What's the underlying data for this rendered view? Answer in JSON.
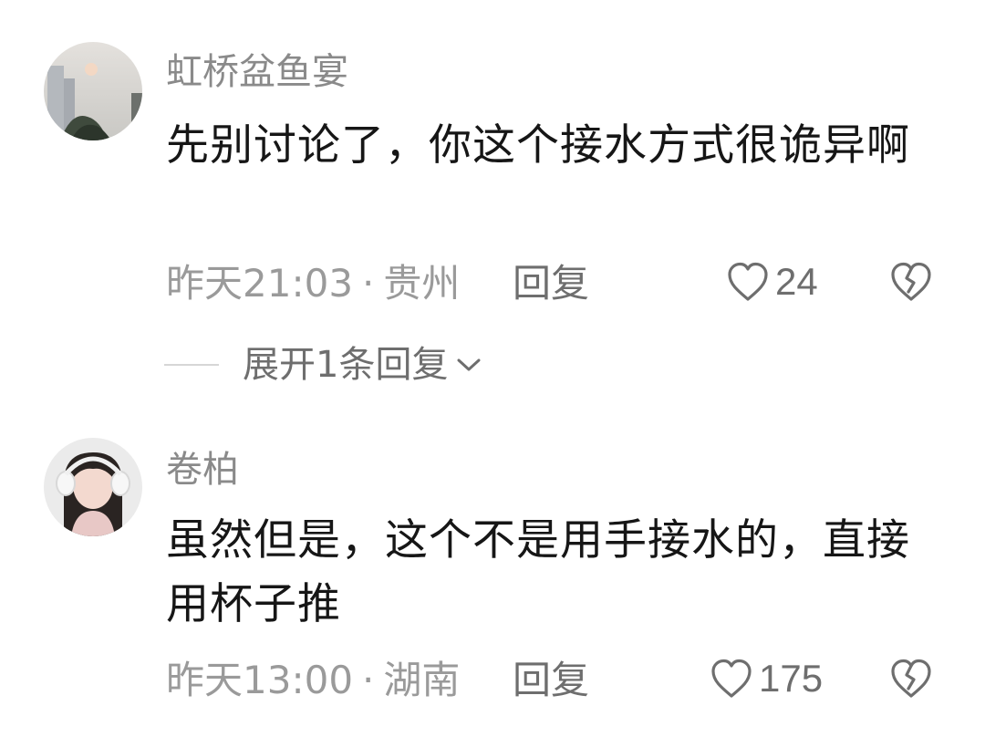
{
  "comments": [
    {
      "username": "虹桥盆鱼宴",
      "text": "先别讨论了，你这个接水方式很诡异啊",
      "time": "昨天21:03",
      "location": "贵州",
      "reply_label": "回复",
      "likes": "24",
      "avatar_icon": "landscape-avatar",
      "expand_label": "展开1条回复"
    },
    {
      "username": "卷柏",
      "text": "虽然但是，这个不是用手接水的，直接用杯子推",
      "time": "昨天13:00",
      "location": "湖南",
      "reply_label": "回复",
      "likes": "175",
      "avatar_icon": "girl-avatar"
    }
  ],
  "separator": "·",
  "icons": {
    "like": "heart-outline-icon",
    "dislike": "broken-heart-icon",
    "expand": "chevron-down-icon"
  },
  "colors": {
    "text": "#161616",
    "username": "#8a8a8a",
    "meta": "#9a9a9a",
    "action": "#6e6e6e"
  }
}
